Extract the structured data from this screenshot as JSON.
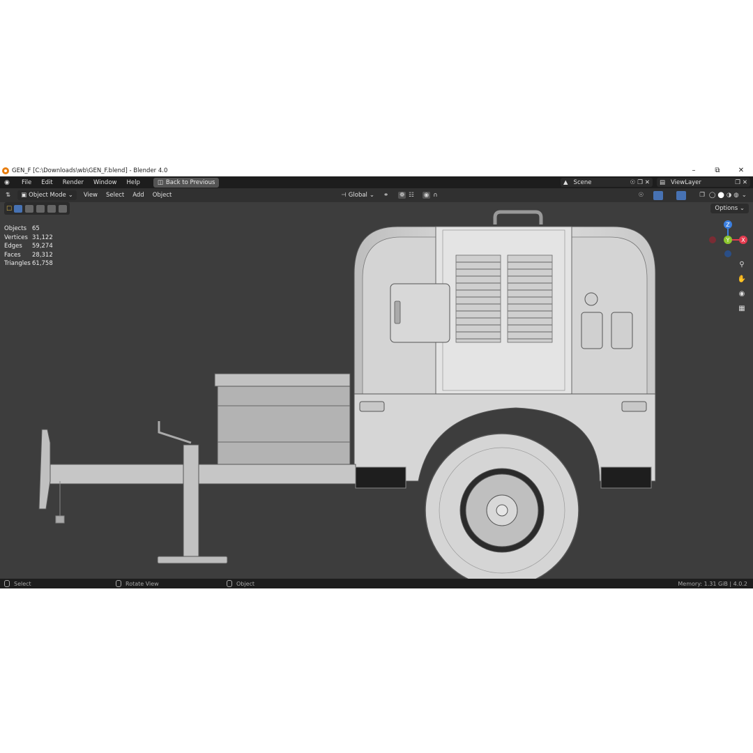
{
  "window": {
    "title": "GEN_F [C:\\Downloads\\wb\\GEN_F.blend] - Blender 4.0"
  },
  "menu": {
    "items": [
      "File",
      "Edit",
      "Render",
      "Window",
      "Help"
    ],
    "back_label": "Back to Previous"
  },
  "scene": {
    "name": "Scene",
    "view_layer": "ViewLayer"
  },
  "header": {
    "mode": "Object Mode",
    "menus": [
      "View",
      "Select",
      "Add",
      "Object"
    ],
    "orientation": "Global"
  },
  "viewport": {
    "options_label": "Options"
  },
  "stats": [
    {
      "label": "Objects",
      "value": "65"
    },
    {
      "label": "Vertices",
      "value": "31,122"
    },
    {
      "label": "Edges",
      "value": "59,274"
    },
    {
      "label": "Faces",
      "value": "28,312"
    },
    {
      "label": "Triangles",
      "value": "61,758"
    }
  ],
  "gizmo": {
    "z": "Z",
    "y": "Y",
    "x": "X"
  },
  "status": {
    "select": "Select",
    "rotate": "Rotate View",
    "object": "Object",
    "memory": "Memory: 1.31 GiB | 4.0.2"
  },
  "colors": {
    "accent_blue": "#4772b3",
    "x_axis": "#e53b4f",
    "y_axis": "#8ec72e",
    "z_axis": "#3b7fe0",
    "viewport_bg": "#3d3d3d"
  }
}
